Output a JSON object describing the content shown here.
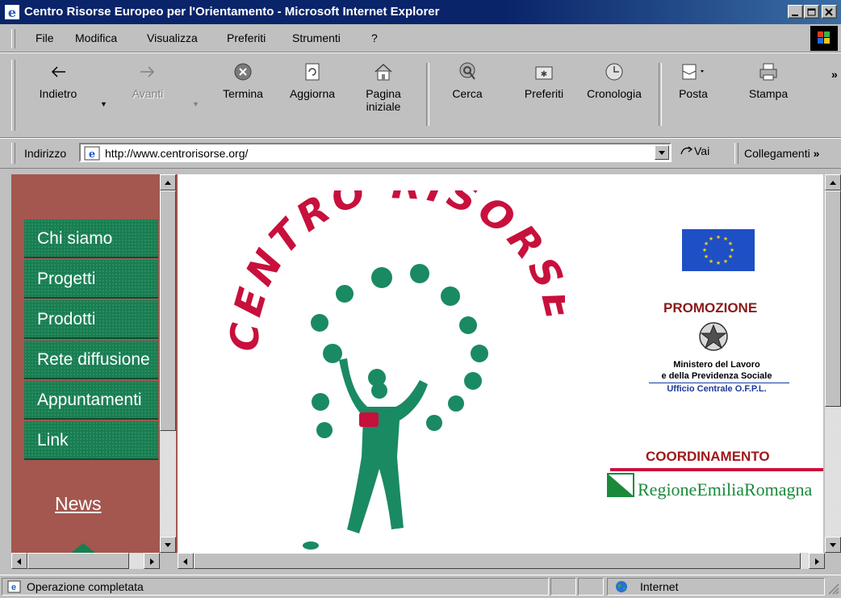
{
  "window": {
    "title": "Centro Risorse Europeo per l'Orientamento - Microsoft Internet Explorer"
  },
  "menu": {
    "items": [
      {
        "label": "File"
      },
      {
        "label": "Modifica"
      },
      {
        "label": "Visualizza"
      },
      {
        "label": "Preferiti"
      },
      {
        "label": "Strumenti"
      },
      {
        "label": "?"
      }
    ]
  },
  "toolbar": {
    "back": "Indietro",
    "forward": "Avanti",
    "stop": "Termina",
    "refresh": "Aggiorna",
    "home_line1": "Pagina",
    "home_line2": "iniziale",
    "search": "Cerca",
    "favorites": "Preferiti",
    "history": "Cronologia",
    "mail": "Posta",
    "print": "Stampa",
    "more": "»"
  },
  "address": {
    "label": "Indirizzo",
    "url": "http://www.centrorisorse.org/",
    "go": "Vai",
    "links": "Collegamenti",
    "links_more": "»"
  },
  "page": {
    "nav": [
      {
        "label": "Chi siamo"
      },
      {
        "label": "Progetti"
      },
      {
        "label": "Prodotti"
      },
      {
        "label": "Rete diffusione"
      },
      {
        "label": "Appuntamenti"
      },
      {
        "label": "Link"
      }
    ],
    "news": "News",
    "logo_word1": "CENTRO",
    "logo_word2": "RISORSE",
    "promo_label": "PROMOZIONE",
    "ministry_line1": "Ministero del Lavoro",
    "ministry_line2": "e della Previdenza Sociale",
    "ministry_line3": "Ufficio Centrale O.F.P.L.",
    "coord_label": "COORDINAMENTO",
    "region": "RegioneEmiliaRomagna"
  },
  "status": {
    "text": "Operazione completata",
    "zone": "Internet"
  },
  "colors": {
    "nav_green": "#1a7d52",
    "frame_brown": "#a3574f",
    "logo_red": "#c8103c",
    "figure_green": "#1a8a63"
  }
}
